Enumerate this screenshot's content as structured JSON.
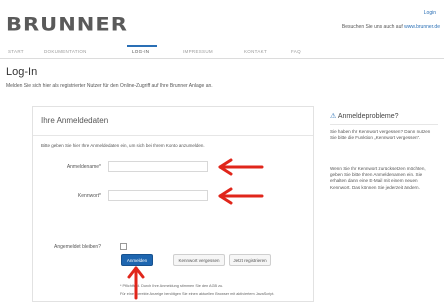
{
  "header": {
    "logo": "BRUNNER",
    "login_link": "Login",
    "visit_prefix": "Besuchen Sie uns auch auf",
    "visit_link": "www.brunner.de"
  },
  "nav": {
    "items": [
      {
        "label": "START"
      },
      {
        "label": "DOKUMENTATION"
      },
      {
        "label": "LOG-IN"
      },
      {
        "label": "IMPRESSUM"
      },
      {
        "label": "KONTAKT"
      },
      {
        "label": "FAQ"
      }
    ],
    "active_index": 2
  },
  "page": {
    "title": "Log-In",
    "description": "Melden Sie sich hier als registrierter Nutzer für den Online-Zugriff auf Ihre Brunner Anlage an."
  },
  "form": {
    "title": "Ihre Anmeldedaten",
    "hint": "Bitte geben Sie hier Ihre Anmeldedaten ein, um sich bei Ihrem Konto anzumelden.",
    "username_label": "Anmeldename*",
    "username_value": "",
    "password_label": "Kennwort*",
    "password_value": "",
    "remember_label": "Angemeldet bleiben?",
    "remember_checked": false,
    "submit_label": "Anmelden",
    "forgot_label": "Kennwort vergessen",
    "register_label": "Jetzt registrieren",
    "note1": "* Pflichtfeld. Durch Ihre Anmeldung stimmen Sie den AGB zu.",
    "note2": "Für eine korrekte Anzeige benötigen Sie einen aktuellen Browser mit aktiviertem JavaScript."
  },
  "sidebar": {
    "title": "Anmeldeprobleme?",
    "para1": "Sie haben Ihr Kennwort vergessen? Dann nutzen Sie bitte die Funktion „Kennwort vergessen“.",
    "para2": "Wenn Sie Ihr Kennwort zurücksetzen möchten, geben Sie bitte Ihren Anmeldenamen ein. Sie erhalten dann eine E-Mail mit einem neuen Kennwort. Das können Sie jederzeit ändern."
  },
  "colors": {
    "accent": "#1e66b0",
    "arrow": "#e0261b"
  }
}
